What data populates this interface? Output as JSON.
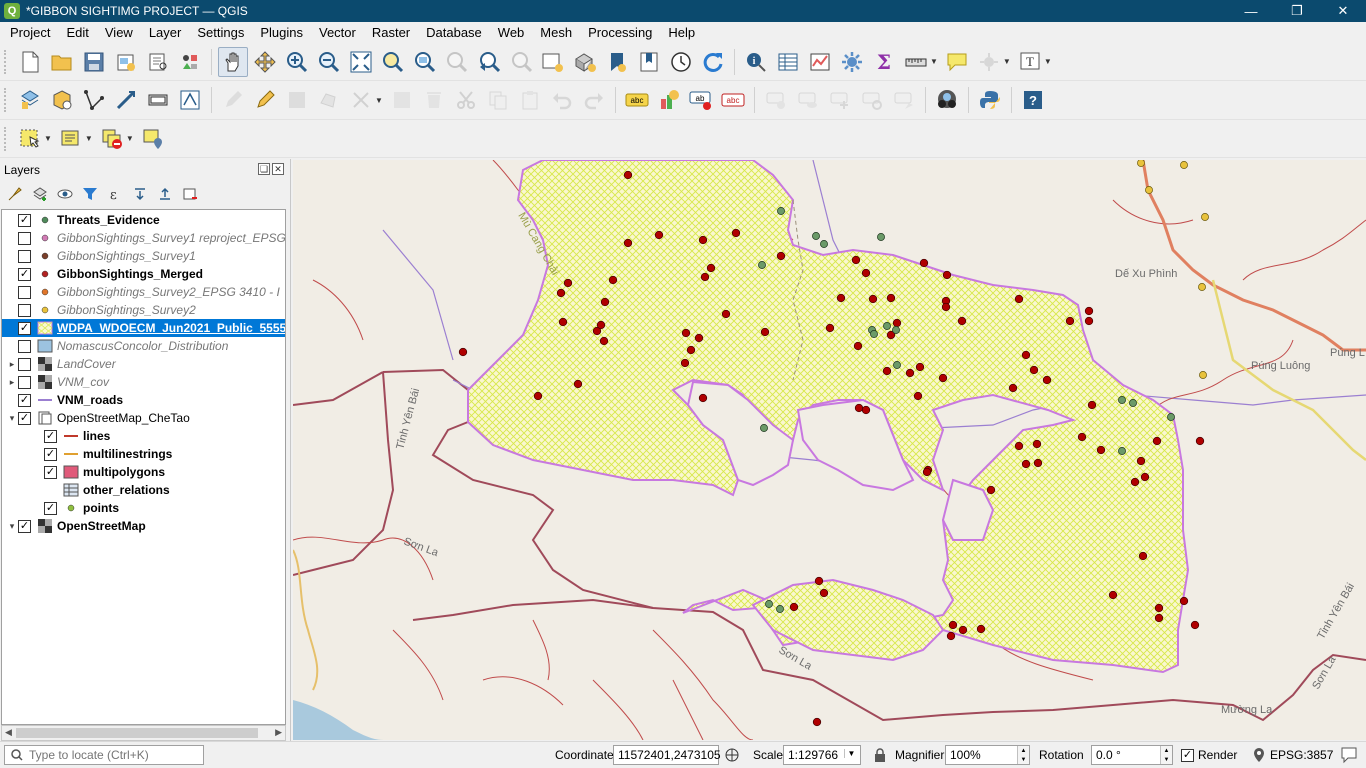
{
  "window": {
    "title": "*GIBBON SIGHTIMG PROJECT — QGIS",
    "controls": [
      "minimize-icon",
      "restore-icon",
      "close-icon"
    ]
  },
  "menubar": {
    "items": [
      "Project",
      "Edit",
      "View",
      "Layer",
      "Settings",
      "Plugins",
      "Vector",
      "Raster",
      "Database",
      "Web",
      "Mesh",
      "Processing",
      "Help"
    ]
  },
  "layers_panel": {
    "title": "Layers",
    "items": [
      {
        "name": "Threats_Evidence",
        "checked": true,
        "style": "bold",
        "symbol": "point",
        "color": "#4f8a5a"
      },
      {
        "name": "GibbonSightings_Survey1 reproject_EPSG",
        "checked": false,
        "style": "dim",
        "symbol": "point",
        "color": "#d27bb5"
      },
      {
        "name": "GibbonSightings_Survey1",
        "checked": false,
        "style": "dim",
        "symbol": "point",
        "color": "#7a3f2a"
      },
      {
        "name": "GibbonSightings_Merged",
        "checked": true,
        "style": "bold",
        "symbol": "point",
        "color": "#b22222"
      },
      {
        "name": "GibbonSightings_Survey2_EPSG 3410 - I",
        "checked": false,
        "style": "dim",
        "symbol": "point",
        "color": "#e0762b"
      },
      {
        "name": "GibbonSightings_Survey2",
        "checked": false,
        "style": "dim",
        "symbol": "point",
        "color": "#e8c23c"
      },
      {
        "name": "WDPA_WDOECM_Jun2021_Public_5555",
        "checked": true,
        "style": "selected",
        "symbol": "hatch",
        "color": "#d7e84a"
      },
      {
        "name": "NomascusConcolor_Distribution",
        "checked": false,
        "style": "dim",
        "symbol": "fill",
        "color": "#9cc3e0"
      },
      {
        "name": "LandCover",
        "checked": false,
        "style": "dim",
        "symbol": "raster",
        "color": "#555555",
        "expander": "closed"
      },
      {
        "name": "VNM_cov",
        "checked": false,
        "style": "dim",
        "symbol": "raster",
        "color": "#555555",
        "expander": "closed"
      },
      {
        "name": "VNM_roads",
        "checked": true,
        "style": "bold",
        "symbol": "line",
        "color": "#9b7fd1"
      },
      {
        "name": "OpenStreetMap_CheTao",
        "checked": true,
        "style": "normal",
        "symbol": "group",
        "color": "#555555",
        "expander": "open"
      },
      {
        "name": "lines",
        "checked": true,
        "style": "bold",
        "symbol": "line",
        "color": "#c0392b",
        "indent": 1
      },
      {
        "name": "multilinestrings",
        "checked": true,
        "style": "bold",
        "symbol": "line",
        "color": "#e0a030",
        "indent": 1
      },
      {
        "name": "multipolygons",
        "checked": true,
        "style": "bold",
        "symbol": "fill",
        "color": "#e05a7a",
        "indent": 1
      },
      {
        "name": "other_relations",
        "checked": null,
        "style": "bold",
        "symbol": "table",
        "color": "#555555",
        "indent": 1
      },
      {
        "name": "points",
        "checked": true,
        "style": "bold",
        "symbol": "point",
        "color": "#8fbf3f",
        "indent": 1
      },
      {
        "name": "OpenStreetMap",
        "checked": true,
        "style": "bold",
        "symbol": "raster",
        "color": "#555555",
        "expander": "open"
      }
    ]
  },
  "map": {
    "labels": [
      "Dế Xu Phình",
      "Púng Luông",
      "Púng L",
      "Tỉnh Yên Bái",
      "Tỉnh Yên Bái",
      "Sơn La",
      "Sơn La",
      "Sơn La",
      "Mường La",
      "Mù Cang Chải"
    ],
    "colors": {
      "background": "#f1ede5",
      "hatch": "#d7e84a",
      "outline": "#c878e0",
      "sighting": "#b00000",
      "threat": "#6b9a68",
      "roads": "#b63a3a"
    }
  },
  "statusbar": {
    "locate_placeholder": "Type to locate (Ctrl+K)",
    "coordinate_label": "Coordinate",
    "coordinate_value": "11572401,2473105",
    "scale_label": "Scale",
    "scale_value": "1:129766",
    "magnifier_label": "Magnifier",
    "magnifier_value": "100%",
    "rotation_label": "Rotation",
    "rotation_value": "0.0 °",
    "render_label": "Render",
    "crs": "EPSG:3857"
  }
}
